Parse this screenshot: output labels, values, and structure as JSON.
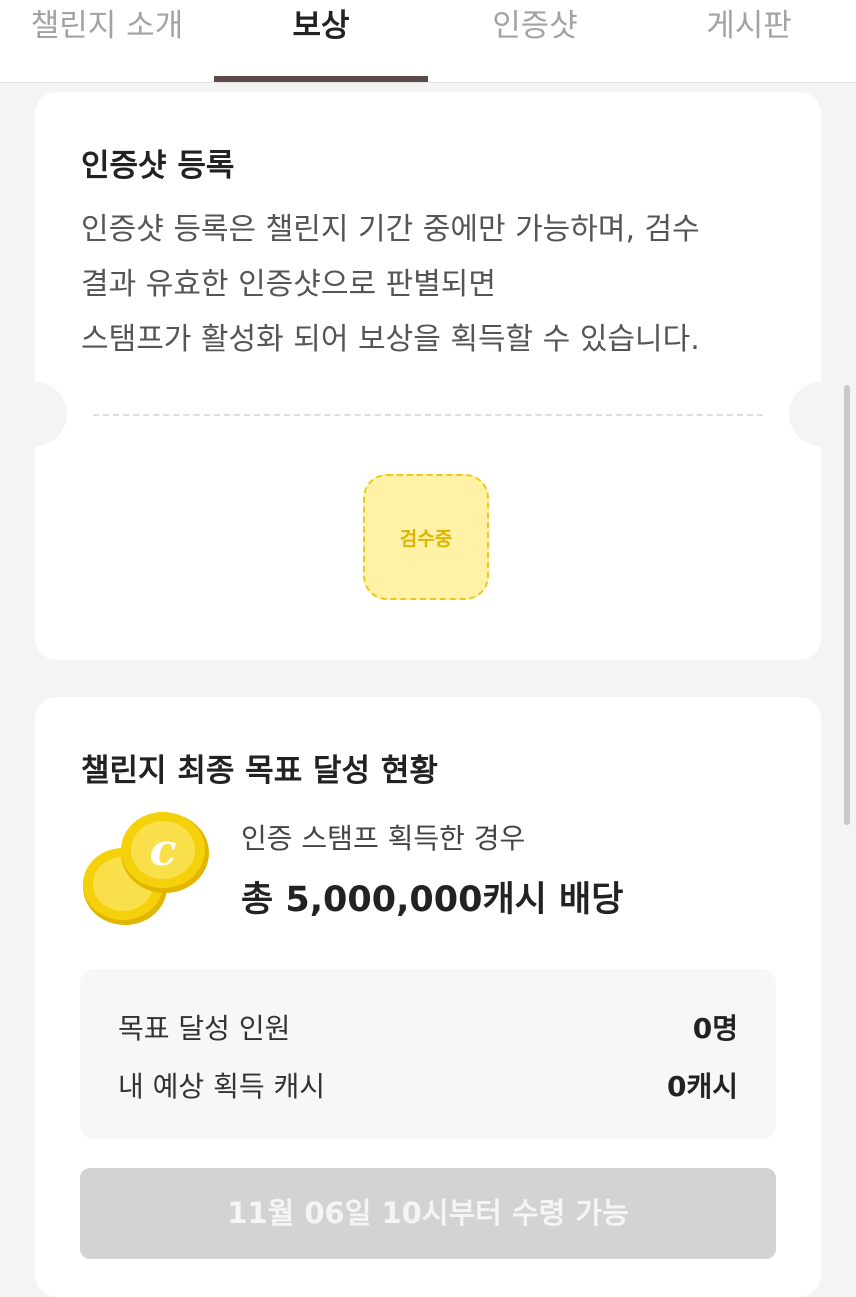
{
  "tabs": [
    {
      "label": "챌린지 소개",
      "active": false
    },
    {
      "label": "보상",
      "active": true
    },
    {
      "label": "인증샷",
      "active": false
    },
    {
      "label": "게시판",
      "active": false
    }
  ],
  "registration": {
    "title": "인증샷 등록",
    "description_lines": [
      "인증샷 등록은 챌린지 기간 중에만 가능하며, 검수",
      "결과 유효한 인증샷으로 판별되면",
      "스탬프가 활성화 되어 보상을 획득할 수 있습니다."
    ],
    "stamp_label": "검수중"
  },
  "goal": {
    "title": "챌린지 최종 목표 달성 현황",
    "reward_condition": "인증 스탬프 획득한 경우",
    "reward_amount": "총 5,000,000캐시 배당",
    "coin_icon": "coin-icon",
    "stats": [
      {
        "label": "목표 달성 인원",
        "value": "0명"
      },
      {
        "label": "내 예상 획득 캐시",
        "value": "0캐시"
      }
    ],
    "claim_button_label": "11월 06일 10시부터 수령 가능"
  },
  "colors": {
    "accent_underline": "#5a4a4a",
    "stamp_fill": "#fff1a6",
    "stamp_text": "#d9b700",
    "coin": "#f5d10c",
    "button_disabled": "#d3d3d3"
  }
}
